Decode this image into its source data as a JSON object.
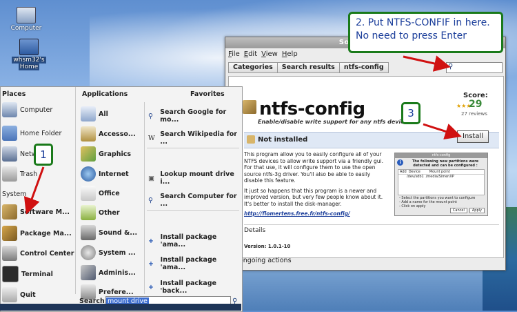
{
  "desktop": {
    "icons": [
      {
        "label": "Computer",
        "icon": "computer-icon"
      },
      {
        "label": "whsm32's",
        "label2": "Home",
        "icon": "home-folder-icon"
      }
    ]
  },
  "software_manager": {
    "title": "Software Ma",
    "menu": [
      "File",
      "Edit",
      "View",
      "Help"
    ],
    "breadcrumbs": [
      "Categories",
      "Search results",
      "ntfs-config"
    ],
    "search_value": "",
    "package": {
      "name": "ntfs-config",
      "summary": "Enable/disable write support for any ntfs devices",
      "score_label": "Score:",
      "score": "29",
      "reviews": "27 reviews",
      "status": "Not installed",
      "install_label": "Install",
      "description": [
        "This program allow you to easily configure all of your NTFS devices to allow write support via a friendly gui. For that use, it will configure them to use the open source ntfs-3g driver. You'll also be able to easily disable this feature.",
        "It just so happens that this program is a newer and improved version, but very few people know about it. It's better to install the disk-manager."
      ],
      "link": "http://flomertens.free.fr/ntfs-config/",
      "details_label": "Details",
      "version": "Version: 1.0.1-10"
    },
    "screenshot": {
      "title": "ntfs-config",
      "heading": "The following new partitions were detected and can be configured :",
      "cols": [
        "Add",
        "Device",
        "Mount point"
      ],
      "row": [
        "/dev/sdb1",
        "/media/SimenXP"
      ],
      "notes": [
        "- Select the partitions you want to configure",
        "- Add a name for the mount point",
        "- Click on apply"
      ],
      "cancel": "Cancel",
      "apply": "Apply"
    },
    "ongoing": "No ongoing actions"
  },
  "menu": {
    "places_header": "Places",
    "places": [
      "Computer",
      "Home Folder",
      "Netw",
      "Trash"
    ],
    "system_header": "System",
    "system": [
      "Software M...",
      "Package Ma...",
      "Control Center",
      "Terminal",
      "Quit"
    ],
    "applications_header": "Applications",
    "applications": [
      "All",
      "Accesso...",
      "Graphics",
      "Internet",
      "Office",
      "Other",
      "Sound &...",
      "System ...",
      "Adminis...",
      "Prefere..."
    ],
    "favorites_header": "Favorites",
    "favorites": [
      "Search Google for mo...",
      "Search Wikipedia for ...",
      "Lookup mount drive i...",
      "Search Computer for ...",
      "Install package 'ama...",
      "Install package 'ama...",
      "Install package 'back..."
    ],
    "search_label": "Search:",
    "search_value": "mount drive"
  },
  "callouts": {
    "step1": "1",
    "step2": "2. Put NTFS-CONFIF in here. No need to press Enter",
    "step3": "3"
  }
}
